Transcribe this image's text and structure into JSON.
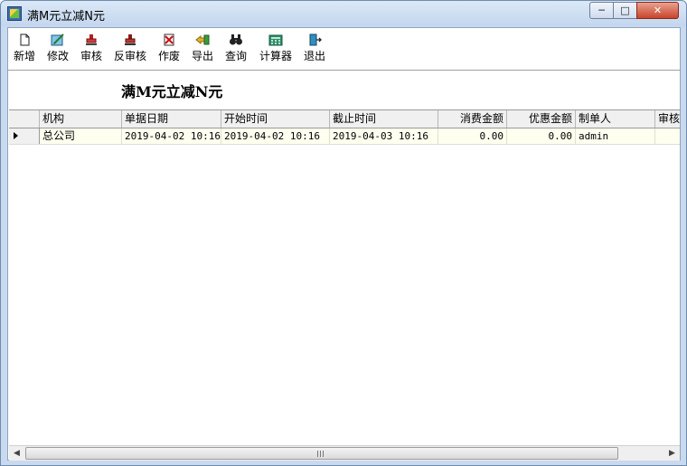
{
  "window": {
    "title": "满M元立减N元",
    "controls": {
      "minimize": "─",
      "maximize": "□",
      "close": "✕"
    }
  },
  "toolbar": {
    "items": [
      {
        "label": "新增",
        "icon": "new-document-icon"
      },
      {
        "label": "修改",
        "icon": "edit-icon"
      },
      {
        "label": "审核",
        "icon": "approve-stamp-icon"
      },
      {
        "label": "反审核",
        "icon": "unapprove-stamp-icon"
      },
      {
        "label": "作废",
        "icon": "void-icon"
      },
      {
        "label": "导出",
        "icon": "export-icon"
      },
      {
        "label": "查询",
        "icon": "binoculars-icon"
      },
      {
        "label": "计算器",
        "icon": "calculator-icon"
      },
      {
        "label": "退出",
        "icon": "exit-icon"
      }
    ]
  },
  "page": {
    "heading": "满M元立减N元"
  },
  "grid": {
    "columns": [
      "机构",
      "单据日期",
      "开始时间",
      "截止时间",
      "消费金额",
      "优惠金额",
      "制单人",
      "审核"
    ],
    "rows": [
      {
        "org": "总公司",
        "bill_date": "2019-04-02 10:16",
        "start_time": "2019-04-02 10:16",
        "end_time": "2019-04-03 10:16",
        "spend_amount": "0.00",
        "discount_amount": "0.00",
        "creator": "admin",
        "reviewer": ""
      }
    ]
  },
  "scrollbar": {
    "left_arrow": "◀",
    "right_arrow": "▶"
  },
  "colors": {
    "row_background": "#fffff0",
    "header_background": "#f0f0f0",
    "title_bar": "#c3d6ee"
  }
}
